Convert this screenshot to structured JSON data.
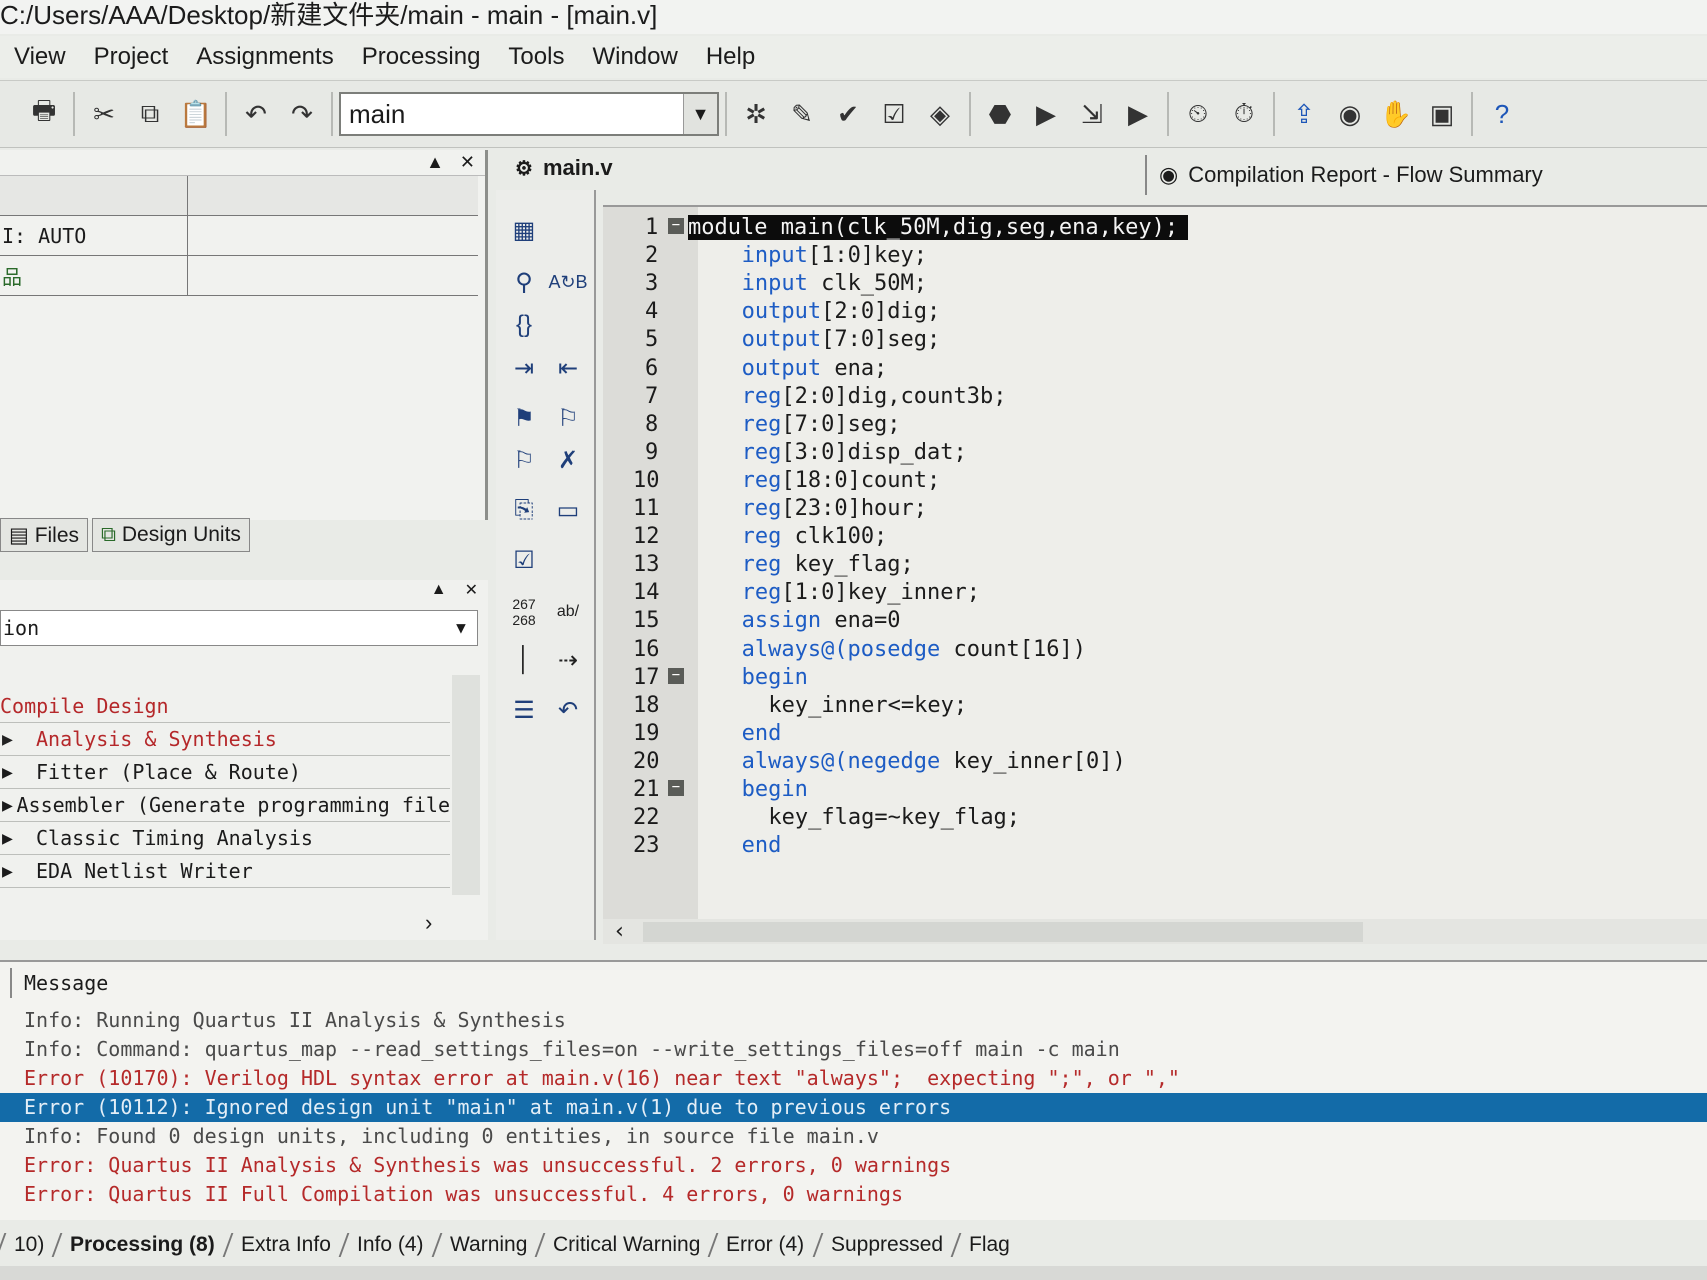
{
  "window": {
    "title": "C:/Users/AAA/Desktop/新建文件夹/main - main - [main.v]"
  },
  "menu": [
    "View",
    "Project",
    "Assignments",
    "Processing",
    "Tools",
    "Window",
    "Help"
  ],
  "toolbar": {
    "entity_value": "main"
  },
  "project_panel": {
    "rows": [
      {
        "col1": "I: AUTO",
        "col2": ""
      },
      {
        "col1": "",
        "col2": ""
      }
    ],
    "tabs": [
      "Files",
      "Design Units"
    ]
  },
  "tasks_panel": {
    "flow_value": "ion",
    "items": [
      {
        "label": "Compile Design",
        "color": "#b5282a",
        "arrow": false
      },
      {
        "label": "Analysis & Synthesis",
        "color": "#b5282a",
        "arrow": true
      },
      {
        "label": "Fitter (Place & Route)",
        "color": "#1b1b1b",
        "arrow": true
      },
      {
        "label": "Assembler (Generate programming file",
        "color": "#1b1b1b",
        "arrow": true
      },
      {
        "label": "Classic Timing Analysis",
        "color": "#1b1b1b",
        "arrow": true
      },
      {
        "label": "EDA Netlist Writer",
        "color": "#1b1b1b",
        "arrow": true
      }
    ]
  },
  "editor": {
    "tab_label": "main.v",
    "report_tab_label": "Compilation Report - Flow Summary",
    "lines": [
      {
        "n": "1",
        "kw": "",
        "code": "module main(clk_50M,dig,seg,ena,key);",
        "fold": true,
        "indent": 0,
        "highlight": true
      },
      {
        "n": "2",
        "kw": "input",
        "code": "[1:0]key;",
        "fold": false,
        "indent": 4
      },
      {
        "n": "3",
        "kw": "input",
        "code": " clk_50M;",
        "fold": false,
        "indent": 4
      },
      {
        "n": "4",
        "kw": "output",
        "code": "[2:0]dig;",
        "fold": false,
        "indent": 4
      },
      {
        "n": "5",
        "kw": "output",
        "code": "[7:0]seg;",
        "fold": false,
        "indent": 4
      },
      {
        "n": "6",
        "kw": "output",
        "code": " ena;",
        "fold": false,
        "indent": 4
      },
      {
        "n": "7",
        "kw": "reg",
        "code": "[2:0]dig,count3b;",
        "fold": false,
        "indent": 4
      },
      {
        "n": "8",
        "kw": "reg",
        "code": "[7:0]seg;",
        "fold": false,
        "indent": 4
      },
      {
        "n": "9",
        "kw": "reg",
        "code": "[3:0]disp_dat;",
        "fold": false,
        "indent": 4
      },
      {
        "n": "10",
        "kw": "reg",
        "code": "[18:0]count;",
        "fold": false,
        "indent": 4
      },
      {
        "n": "11",
        "kw": "reg",
        "code": "[23:0]hour;",
        "fold": false,
        "indent": 4
      },
      {
        "n": "12",
        "kw": "reg",
        "code": " clk100;",
        "fold": false,
        "indent": 4
      },
      {
        "n": "13",
        "kw": "reg",
        "code": " key_flag;",
        "fold": false,
        "indent": 4
      },
      {
        "n": "14",
        "kw": "reg",
        "code": "[1:0]key_inner;",
        "fold": false,
        "indent": 4
      },
      {
        "n": "15",
        "kw": "assign",
        "code": " ena=0",
        "fold": false,
        "indent": 4
      },
      {
        "n": "16",
        "kw": "always@(posedge",
        "code": " count[16])",
        "fold": false,
        "indent": 4
      },
      {
        "n": "17",
        "kw": "begin",
        "code": "",
        "fold": true,
        "indent": 4
      },
      {
        "n": "18",
        "kw": "",
        "code": "key_inner<=key;",
        "fold": false,
        "indent": 6
      },
      {
        "n": "19",
        "kw": "end",
        "code": "",
        "fold": false,
        "indent": 4
      },
      {
        "n": "20",
        "kw": "always@(negedge",
        "code": " key_inner[0])",
        "fold": false,
        "indent": 4
      },
      {
        "n": "21",
        "kw": "begin",
        "code": "",
        "fold": true,
        "indent": 4
      },
      {
        "n": "22",
        "kw": "",
        "code": "key_flag=~key_flag;",
        "fold": false,
        "indent": 6
      },
      {
        "n": "23",
        "kw": "end",
        "code": "",
        "fold": false,
        "indent": 4
      }
    ]
  },
  "messages": {
    "header": "Message",
    "lines": [
      {
        "type": "info",
        "text": "Info: Running Quartus II Analysis & Synthesis"
      },
      {
        "type": "info",
        "text": "Info: Command: quartus_map --read_settings_files=on --write_settings_files=off main -c main"
      },
      {
        "type": "err",
        "text": "Error (10170): Verilog HDL syntax error at main.v(16) near text \"always\";  expecting \";\", or \",\""
      },
      {
        "type": "sel",
        "text": "Error (10112): Ignored design unit \"main\" at main.v(1) due to previous errors"
      },
      {
        "type": "info",
        "text": "Info: Found 0 design units, including 0 entities, in source file main.v"
      },
      {
        "type": "err",
        "text": "Error: Quartus II Analysis & Synthesis was unsuccessful. 2 errors, 0 warnings"
      },
      {
        "type": "err",
        "text": "Error: Quartus II Full Compilation was unsuccessful. 4 errors, 0 warnings"
      }
    ]
  },
  "bottom_tabs": [
    {
      "label": "10)",
      "active": false
    },
    {
      "label": "Processing (8)",
      "active": true
    },
    {
      "label": "Extra Info",
      "active": false
    },
    {
      "label": "Info (4)",
      "active": false
    },
    {
      "label": "Warning",
      "active": false
    },
    {
      "label": "Critical Warning",
      "active": false
    },
    {
      "label": "Error (4)",
      "active": false
    },
    {
      "label": "Suppressed",
      "active": false
    },
    {
      "label": "Flag",
      "active": false
    }
  ]
}
